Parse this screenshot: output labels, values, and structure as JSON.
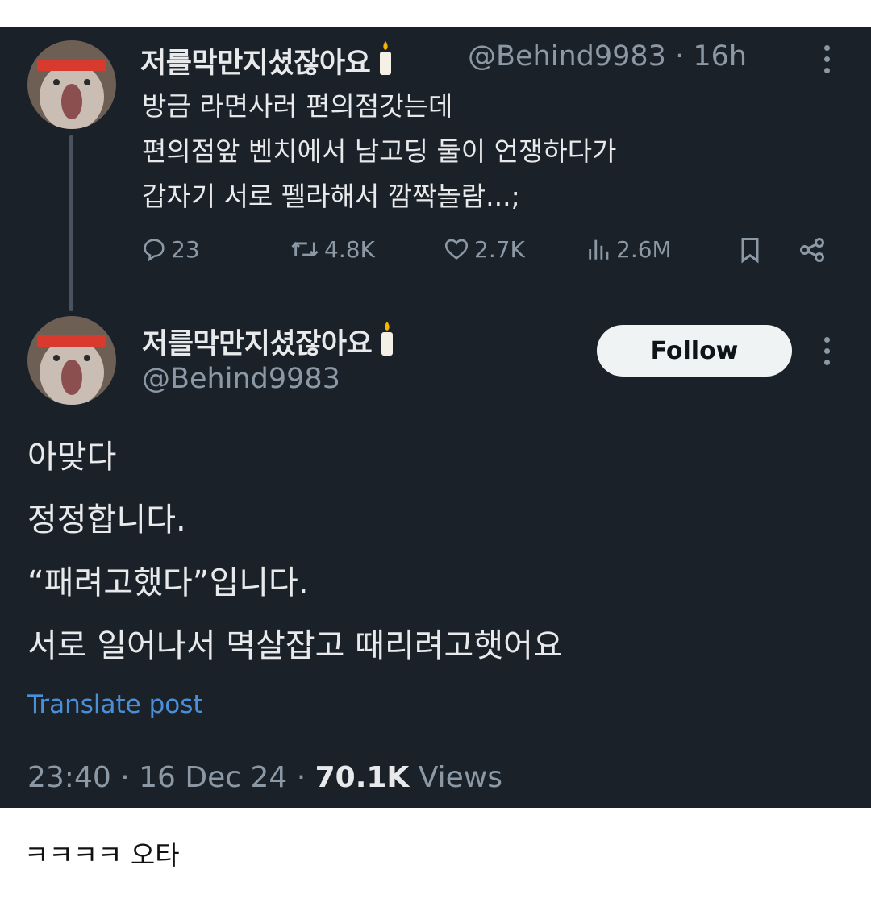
{
  "post1": {
    "name": "저를막만지셨잖아요",
    "handle": "@Behind9983",
    "separator": "·",
    "time": "16h",
    "lines": [
      "방금 라면사러 편의점갓는데",
      "편의점앞 벤치에서 남고딩 둘이 언쟁하다가",
      "갑자기 서로 펠라해서 깜짝놀람...;"
    ],
    "replies": "23",
    "reposts": "4.8K",
    "likes": "2.7K",
    "views": "2.6M"
  },
  "post2": {
    "name": "저를막만지셨잖아요",
    "handle": "@Behind9983",
    "follow_label": "Follow",
    "lines": [
      "아맞다",
      "정정합니다.",
      "“패려고했다”입니다.",
      "서로 일어나서 멱살잡고 때리려고햇어요"
    ],
    "translate_label": "Translate post",
    "time": "23:40",
    "date": "16 Dec 24",
    "views_count": "70.1K",
    "views_label": "Views"
  },
  "caption": "ㅋㅋㅋㅋ 오타",
  "colors": {
    "background": "#1b2129",
    "text": "#e7e9ea",
    "muted": "#8b98a5",
    "link": "#4a90d9"
  }
}
